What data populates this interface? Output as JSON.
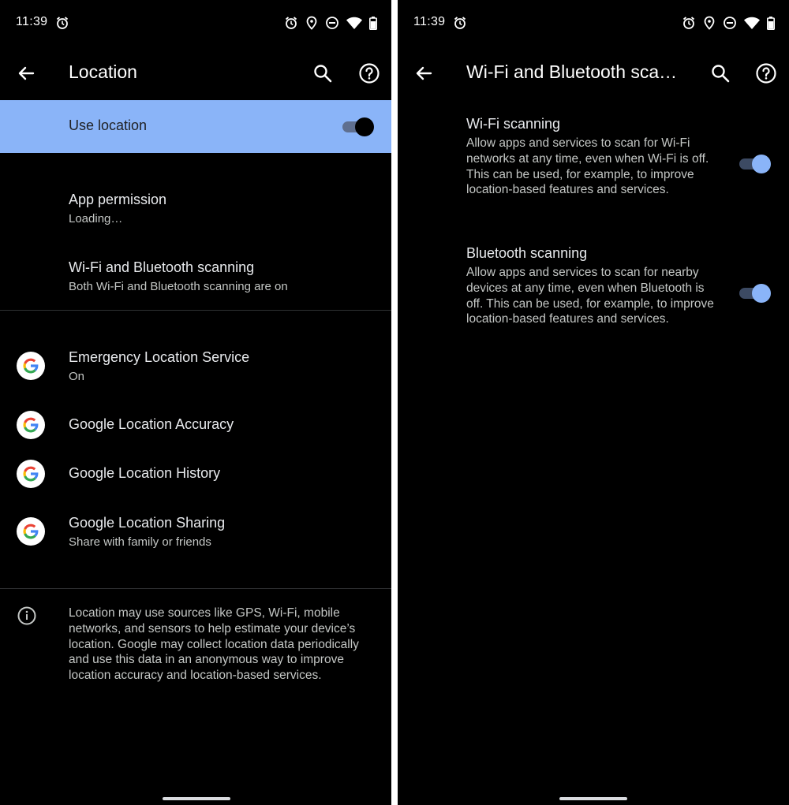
{
  "left": {
    "status": {
      "time": "11:39"
    },
    "app_bar": {
      "title": "Location"
    },
    "main_switch": {
      "label": "Use location",
      "on": true
    },
    "items": [
      {
        "title": "App permission",
        "subtitle": "Loading…"
      },
      {
        "title": "Wi-Fi and Bluetooth scanning",
        "subtitle": "Both Wi-Fi and Bluetooth scanning are on"
      }
    ],
    "services": [
      {
        "title": "Emergency Location Service",
        "subtitle": "On",
        "icon": "google-g-icon"
      },
      {
        "title": "Google Location Accuracy",
        "icon": "google-g-icon"
      },
      {
        "title": "Google Location History",
        "icon": "google-g-icon"
      },
      {
        "title": "Google Location Sharing",
        "subtitle": "Share with family or friends",
        "icon": "google-g-icon"
      }
    ],
    "footer": "Location may use sources like GPS, Wi-Fi, mobile networks, and sensors to help estimate your device’s location. Google may collect location data periodically and use this data in an anonymous way to improve location accuracy and location-based services."
  },
  "right": {
    "status": {
      "time": "11:39"
    },
    "app_bar": {
      "title": "Wi-Fi and Bluetooth sca…"
    },
    "settings": [
      {
        "title": "Wi-Fi scanning",
        "description": "Allow apps and services to scan for Wi-Fi networks at any time, even when Wi-Fi is off. This can be used, for example, to improve location-based features and services.",
        "on": true
      },
      {
        "title": "Bluetooth scanning",
        "description": "Allow apps and services to scan for nearby devices at any time, even when Bluetooth is off. This can be used, for example, to improve location-based features and services.",
        "on": true
      }
    ]
  },
  "colors": {
    "background": "#000000",
    "accent": "#8ab4f8",
    "text_primary": "#e8eaed",
    "text_secondary": "#c4c7c5"
  }
}
